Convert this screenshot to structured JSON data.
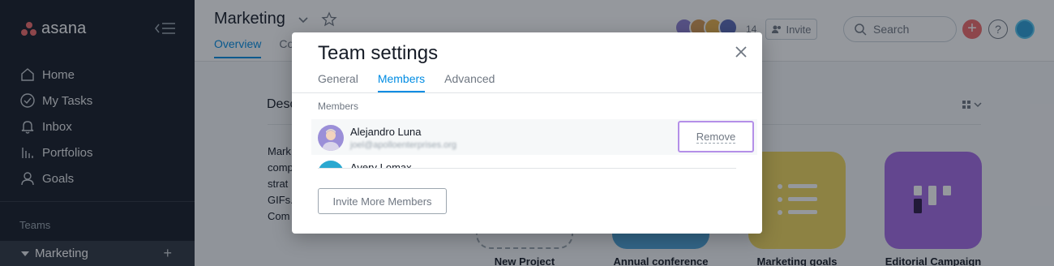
{
  "sidebar": {
    "logo_text": "asana",
    "nav": [
      {
        "label": "Home",
        "icon": "home-icon"
      },
      {
        "label": "My Tasks",
        "icon": "check-circle-icon"
      },
      {
        "label": "Inbox",
        "icon": "bell-icon"
      },
      {
        "label": "Portfolios",
        "icon": "bar-chart-icon"
      },
      {
        "label": "Goals",
        "icon": "person-icon"
      }
    ],
    "teams_label": "Teams",
    "team": {
      "label": "Marketing",
      "add_symbol": "+"
    }
  },
  "header": {
    "title": "Marketing",
    "tabs": [
      {
        "label": "Overview",
        "active": true
      },
      {
        "label": "Co",
        "active": false
      }
    ],
    "member_count": "14",
    "invite_label": "Invite",
    "search_placeholder": "Search",
    "add_symbol": "+",
    "help_symbol": "?"
  },
  "main": {
    "description_title": "Desc",
    "description_text": "Mark\ncomp\nstrat\nGIFs.\nCom",
    "projects": [
      {
        "label": "New Project",
        "color": "#ffffff"
      },
      {
        "label": "Annual conference",
        "color": "#4ba3d8"
      },
      {
        "label": "Marketing goals",
        "color": "#f1d85c"
      },
      {
        "label": "Editorial Campaign",
        "color": "#a56ae6"
      }
    ]
  },
  "modal": {
    "title": "Team settings",
    "tabs": [
      {
        "label": "General",
        "active": false
      },
      {
        "label": "Members",
        "active": true
      },
      {
        "label": "Advanced",
        "active": false
      }
    ],
    "section_label": "Members",
    "members": [
      {
        "name": "Alejandro Luna",
        "email": "joel@apolloenterprises.org",
        "action": "Remove"
      },
      {
        "name": "Avery Lomax"
      }
    ],
    "invite_more_label": "Invite More Members"
  },
  "colors": {
    "accent": "#008ce3",
    "sidebar_bg": "#151b26",
    "brand": "#f06a6a",
    "focus_ring": "#b48fe8"
  }
}
